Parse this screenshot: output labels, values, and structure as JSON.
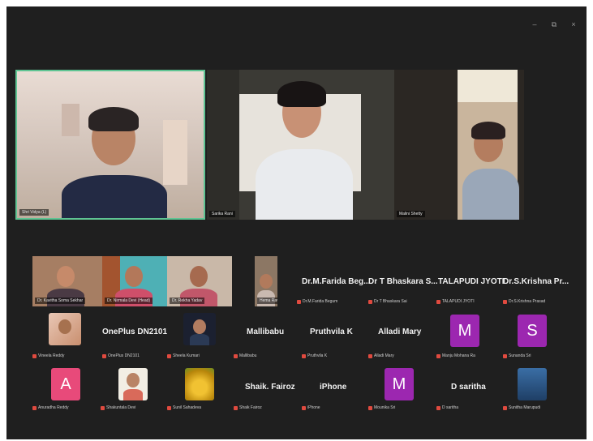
{
  "window": {
    "controls": [
      "–",
      "⧉",
      "×"
    ]
  },
  "featured": [
    {
      "label": "Shri Vidya (L)"
    },
    {
      "label": "Sarika Rani"
    },
    {
      "label": "Malini Shetty"
    }
  ],
  "row1": {
    "video_tiles": [
      {
        "label": "Dr. Kavitha Soma Sekhar"
      },
      {
        "label": "Dr. Nirmala Devi (Head)"
      },
      {
        "label": "Dr. Rekha Yadav"
      },
      {
        "label": "Hema Ravi"
      }
    ],
    "text_tiles": [
      {
        "name": "Dr.M.Farida  Beg...",
        "label": "Dr.M.Farida Begum"
      },
      {
        "name": "Dr T Bhaskara S...",
        "label": "Dr T Bhaskara Sai"
      },
      {
        "name": "TALAPUDI JYOTI",
        "label": "TALAPUDI JYOTI"
      },
      {
        "name": "Dr.S.Krishna  Pr...",
        "label": "Dr.S.Krishna Prasad"
      }
    ]
  },
  "row2": [
    {
      "name": "",
      "label": "Vineela Reddy",
      "avatar": "photo-child"
    },
    {
      "name": "OnePlus DN2101",
      "label": "OnePlus DN2101"
    },
    {
      "name": "",
      "label": "Sheela Kumari",
      "avatar": "photo-woman"
    },
    {
      "name": "Mallibabu",
      "label": "Mallibabu"
    },
    {
      "name": "Pruthvila K",
      "label": "Pruthvila K"
    },
    {
      "name": "Alladi Mary",
      "label": "Alladi Mary"
    },
    {
      "name": "",
      "label": "Manju Mohana Ra",
      "letter": "M",
      "color": "#9c27b0"
    },
    {
      "name": "",
      "label": "Sunanda Sri",
      "letter": "S",
      "color": "#9c27b0"
    }
  ],
  "row3": [
    {
      "name": "",
      "label": "Anuradha Reddy",
      "letter": "A",
      "color": "#e84a7a"
    },
    {
      "name": "",
      "label": "Shakuntala Devi",
      "avatar": "photo-portrait"
    },
    {
      "name": "",
      "label": "Sunil Sahadeva",
      "avatar": "photo-flowers"
    },
    {
      "name": "Shaik.  Fairoz",
      "label": "Shaik Fairoz"
    },
    {
      "name": "iPhone",
      "label": "iPhone"
    },
    {
      "name": "",
      "label": "Mounika Sri",
      "letter": "M",
      "color": "#9c27b0"
    },
    {
      "name": "D saritha",
      "label": "D saritha"
    },
    {
      "name": "",
      "label": "Sunitha Marupudi",
      "avatar": "photo-blue"
    }
  ]
}
